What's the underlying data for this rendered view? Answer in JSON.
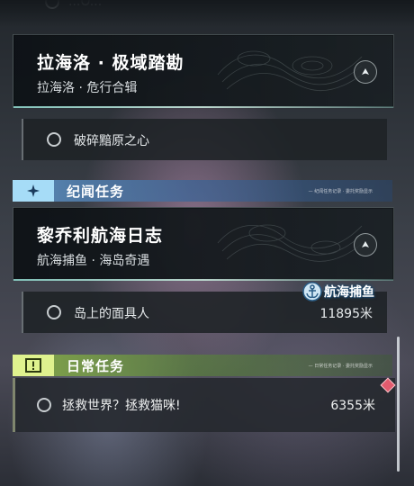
{
  "partial_top": {
    "label": "...Ô..."
  },
  "quest1": {
    "title": "拉海洛 · 极域踏勘",
    "subtitle": "拉海洛 · 危行合辑",
    "badge_icon": "direction-arrow-icon",
    "task": {
      "label": "破碎黯原之心",
      "distance": ""
    }
  },
  "section_story": {
    "name": "纪闻任务",
    "icon": "sparkle-icon",
    "fine_print": "— 纪闻任务记录 · 委托奖励显示"
  },
  "quest2": {
    "title": "黎乔利航海日志",
    "subtitle": "航海捕鱼 · 海岛奇遇",
    "badge_icon": "direction-arrow-icon",
    "tag": {
      "label": "航海捕鱼",
      "icon": "anchor-icon"
    },
    "task": {
      "label": "岛上的面具人",
      "distance": "11895米"
    }
  },
  "section_daily": {
    "name": "日常任务",
    "icon": "exclamation-icon",
    "fine_print": "— 日常任务记录 · 委托奖励显示"
  },
  "daily": {
    "label": "拯救世界？拯救猫咪!",
    "distance": "6355米",
    "marker_color": "#e35b6e"
  },
  "colors": {
    "story_accent": "#a6dcf7",
    "daily_accent": "#dff28e"
  }
}
